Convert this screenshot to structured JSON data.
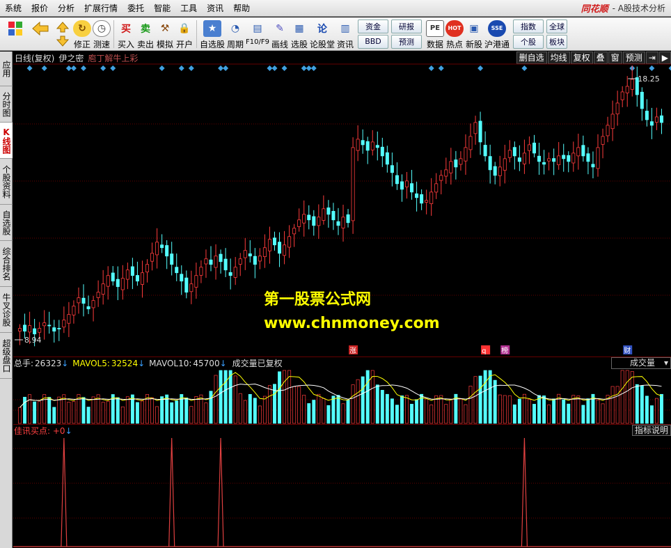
{
  "menu": {
    "items": [
      "系统",
      "报价",
      "分析",
      "扩展行情",
      "委托",
      "智能",
      "工具",
      "资讯",
      "帮助"
    ],
    "brand_logo": "同花顺",
    "brand_sub": "- A股技术分析"
  },
  "toolbar": {
    "buttons": [
      {
        "label": "修正",
        "icon": "↻"
      },
      {
        "label": "测速",
        "icon": "◷"
      },
      {
        "label": "买入",
        "icon": "买"
      },
      {
        "label": "卖出",
        "icon": "卖"
      },
      {
        "label": "模拟",
        "icon": "⚒"
      },
      {
        "label": "开户",
        "icon": "🔒"
      },
      {
        "label": "自选股",
        "icon": "★"
      },
      {
        "label": "周期",
        "icon": "◔"
      },
      {
        "label": "F10/F9",
        "icon": "▤"
      },
      {
        "label": "画线",
        "icon": "✎"
      },
      {
        "label": "选股",
        "icon": "▦"
      },
      {
        "label": "论股堂",
        "icon": "论"
      },
      {
        "label": "资讯",
        "icon": "▥"
      }
    ],
    "small_left": [
      "资金",
      "BBD"
    ],
    "small_right": [
      "研报",
      "预测"
    ],
    "buttons2": [
      {
        "label": "数据",
        "icon": "PE"
      },
      {
        "label": "热点",
        "icon": "HOT"
      },
      {
        "label": "新股",
        "icon": "▣"
      },
      {
        "label": "沪港通",
        "icon": "SSE"
      }
    ],
    "small_far": [
      "指数",
      "个股"
    ],
    "small_far2": [
      "全球",
      "板块"
    ]
  },
  "sidebar": {
    "tabs": [
      "应用",
      "分时图",
      "K线图",
      "个股资料",
      "自选股",
      "综合排名",
      "牛叉诊股",
      "超级盘口"
    ],
    "active_index": 2
  },
  "price_panel": {
    "period_label": "日线(复权)",
    "stock_name": "伊之密",
    "indicator_label": "庖丁解牛上彩",
    "tools": [
      "删自选",
      "均线",
      "复权",
      "叠",
      "窗",
      "预测"
    ],
    "max_label": "18.25",
    "min_label": "8.94",
    "markers": [
      {
        "text": "涨",
        "color": "#cc2222"
      },
      {
        "text": "q",
        "color": "#ff3333"
      },
      {
        "text": "榜",
        "color": "#b03090"
      },
      {
        "text": "财",
        "color": "#3050c0"
      }
    ]
  },
  "watermark": {
    "line1": "第一股票公式网",
    "line2": "www.chnmoney.com"
  },
  "volume_panel": {
    "total_label": "总手:",
    "total_value": "26323",
    "ma5_label": "MAVOL5:",
    "ma5_value": "32524",
    "ma10_label": "MAVOL10:",
    "ma10_value": "45700",
    "arrow": "↓",
    "note": "成交量已复权",
    "select_value": "成交量"
  },
  "indicator_panel": {
    "name": "佳讯买点: +0",
    "arrow": "↓",
    "explain_button": "指标说明"
  },
  "chart_data": {
    "type": "candlestick",
    "price_range": [
      8.94,
      18.25
    ],
    "close": [
      9.3,
      9.2,
      9.4,
      9.1,
      9.3,
      9.5,
      9.4,
      9.2,
      9.3,
      9.6,
      9.8,
      10.1,
      10.4,
      10.2,
      10.0,
      10.3,
      10.6,
      10.9,
      11.2,
      11.0,
      10.8,
      11.1,
      11.4,
      11.2,
      11.0,
      11.3,
      11.6,
      12.0,
      12.4,
      12.2,
      11.9,
      11.6,
      11.3,
      11.0,
      10.6,
      10.9,
      11.2,
      11.5,
      11.8,
      11.6,
      11.9,
      11.7,
      11.4,
      11.2,
      11.5,
      11.8,
      12.1,
      11.9,
      11.6,
      11.9,
      12.2,
      12.5,
      12.3,
      12.0,
      12.3,
      12.6,
      12.9,
      13.2,
      13.4,
      13.2,
      13.0,
      13.3,
      13.6,
      13.4,
      13.2,
      13.0,
      13.3,
      13.1,
      15.8,
      16.1,
      15.9,
      15.7,
      16.0,
      15.8,
      15.5,
      15.2,
      14.9,
      14.5,
      14.3,
      14.6,
      14.2,
      14.0,
      13.8,
      13.9,
      14.2,
      14.5,
      14.8,
      15.0,
      15.3,
      15.1,
      15.4,
      15.8,
      16.2,
      16.7,
      16.0,
      15.5,
      15.0,
      14.8,
      15.1,
      15.4,
      15.7,
      15.5,
      15.3,
      15.6,
      15.9,
      15.6,
      15.3,
      15.2,
      15.4,
      15.3,
      15.5,
      15.4,
      15.3,
      15.6,
      15.8,
      15.5,
      15.3,
      15.1,
      15.8,
      16.2,
      16.6,
      17.0,
      17.4,
      17.8,
      18.0,
      18.25,
      17.7,
      17.2,
      16.8,
      16.6,
      16.9,
      16.7
    ],
    "volume_peaks_index": [
      42,
      54,
      71,
      95,
      124
    ],
    "signal_indices": [
      9,
      31,
      41,
      103
    ],
    "signal_label": "佳讯买点"
  }
}
